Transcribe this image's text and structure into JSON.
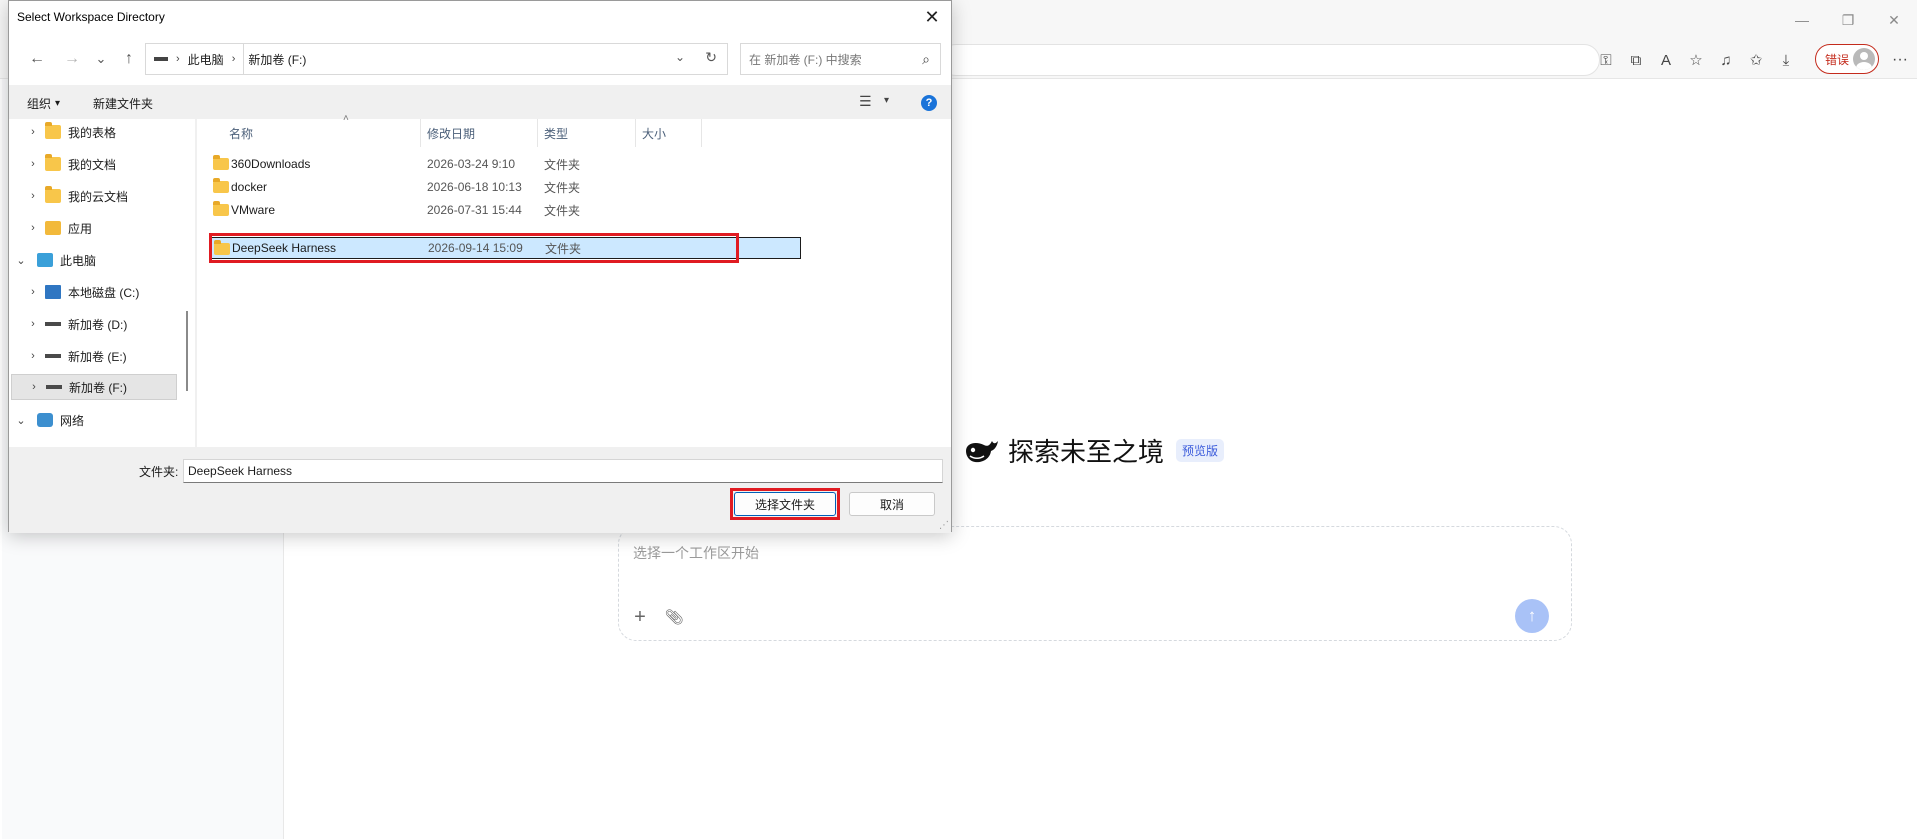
{
  "browser": {
    "controls": {
      "minimize": "—",
      "restore": "❐",
      "close": "✕"
    },
    "toolbar_icons": [
      "key-icon",
      "split-screen-icon",
      "read-aloud-icon",
      "favorite-star-icon",
      "music-icon",
      "favorites-icon",
      "download-icon"
    ],
    "error_label": "错误",
    "more": "···"
  },
  "app": {
    "welcome_title": "探索未至之境",
    "preview_badge": "预览版",
    "composer_placeholder": "选择一个工作区开始",
    "composer_plus": "+",
    "composer_clip": "⌀",
    "composer_send": "↑"
  },
  "dialog": {
    "title": "Select Workspace Directory",
    "close": "✕",
    "nav": {
      "back": "←",
      "forward": "→",
      "recent": "⌄",
      "up": "↑"
    },
    "breadcrumb": {
      "items": [
        "此电脑",
        "新加卷 (F:)"
      ],
      "sep": "›"
    },
    "search_placeholder": "在 新加卷 (F:) 中搜索",
    "commands": {
      "organize": "组织",
      "organize_caret": "▾",
      "new_folder": "新建文件夹"
    },
    "tree": [
      {
        "label": "我的表格",
        "icon": "folder"
      },
      {
        "label": "我的文档",
        "icon": "folder"
      },
      {
        "label": "我的云文档",
        "icon": "folder"
      },
      {
        "label": "应用",
        "icon": "apps"
      },
      {
        "label": "此电脑",
        "icon": "pc",
        "expanded": true
      },
      {
        "label": "本地磁盘 (C:)",
        "icon": "os-drive"
      },
      {
        "label": "新加卷 (D:)",
        "icon": "drive"
      },
      {
        "label": "新加卷 (E:)",
        "icon": "drive"
      },
      {
        "label": "新加卷 (F:)",
        "icon": "drive",
        "selected": true
      },
      {
        "label": "网络",
        "icon": "network",
        "expanded": true
      }
    ],
    "columns": {
      "name": "名称",
      "modified": "修改日期",
      "type": "类型",
      "size": "大小"
    },
    "files": [
      {
        "name": "360Downloads",
        "modified": "2026-03-24 9:10",
        "type": "文件夹"
      },
      {
        "name": "docker",
        "modified": "2026-06-18 10:13",
        "type": "文件夹"
      },
      {
        "name": "VMware",
        "modified": "2026-07-31 15:44",
        "type": "文件夹"
      },
      {
        "name": "DeepSeek Harness",
        "modified": "2026-09-14 15:09",
        "type": "文件夹",
        "selected": true
      }
    ],
    "folder_label": "文件夹:",
    "folder_value": "DeepSeek Harness",
    "select_button": "选择文件夹",
    "cancel_button": "取消"
  },
  "colors": {
    "highlight": "#e01b22",
    "selection": "#cce8ff",
    "accent": "#005fb8",
    "error": "#c42b1c"
  }
}
